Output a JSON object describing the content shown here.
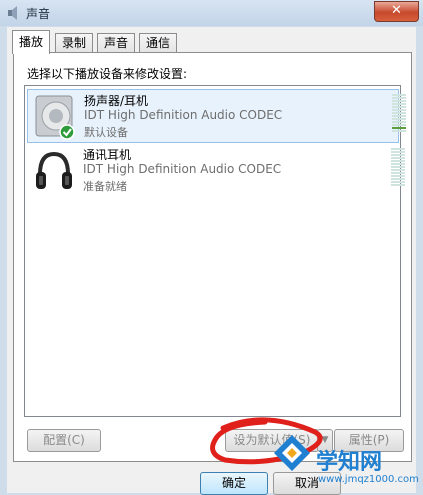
{
  "window": {
    "title": "声音",
    "close_glyph": "✕"
  },
  "tabs": [
    {
      "label": "播放",
      "active": true
    },
    {
      "label": "录制",
      "active": false
    },
    {
      "label": "声音",
      "active": false
    },
    {
      "label": "通信",
      "active": false
    }
  ],
  "playback": {
    "instruction": "选择以下播放设备来修改设置:",
    "devices": [
      {
        "name": "扬声器/耳机",
        "driver": "IDT High Definition Audio CODEC",
        "status": "默认设备",
        "icon": "speaker-icon",
        "is_default": true,
        "selected": true,
        "level_bars": 1
      },
      {
        "name": "通讯耳机",
        "driver": "IDT High Definition Audio CODEC",
        "status": "准备就绪",
        "icon": "headphones-icon",
        "is_default": false,
        "selected": false,
        "level_bars": 0
      }
    ],
    "buttons": {
      "configure": "配置(C)",
      "set_default": "设为默认值(S)",
      "properties": "属性(P)"
    }
  },
  "footer": {
    "ok": "确定",
    "cancel": "取消"
  },
  "watermark": {
    "name": "学知网",
    "url": "www.jmqz1000.com"
  },
  "colors": {
    "default_check": "#2e9c3a",
    "annotation_red": "#e0201b",
    "watermark_blue": "#1f7fd0"
  }
}
